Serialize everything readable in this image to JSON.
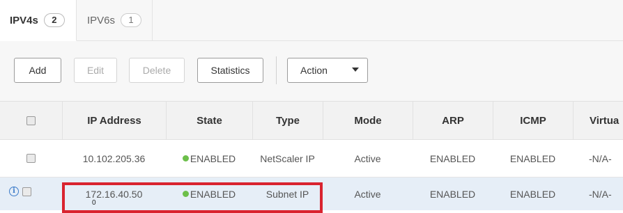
{
  "tabs": [
    {
      "label": "IPV4s",
      "count": "2",
      "active": true
    },
    {
      "label": "IPV6s",
      "count": "1",
      "active": false
    }
  ],
  "toolbar": {
    "add": "Add",
    "edit": "Edit",
    "delete": "Delete",
    "statistics": "Statistics",
    "action": "Action"
  },
  "table": {
    "columns": [
      "IP Address",
      "State",
      "Type",
      "Mode",
      "ARP",
      "ICMP",
      "Virtua"
    ],
    "rows": [
      {
        "ip": "10.102.205.36",
        "state": "ENABLED",
        "type": "NetScaler IP",
        "mode": "Active",
        "arp": "ENABLED",
        "icmp": "ENABLED",
        "virtual": "-N/A-"
      },
      {
        "ip": "172.16.40.50",
        "state": "ENABLED",
        "type": "Subnet IP",
        "mode": "Active",
        "arp": "ENABLED",
        "icmp": "ENABLED",
        "virtual": "-N/A-"
      }
    ],
    "row2_subtext": "0"
  },
  "colors": {
    "enabled_dot": "#6cbf4a",
    "selected_row": "#e6eef7",
    "highlight_border": "#d9232f",
    "info_icon": "#3d7cc9"
  },
  "icons": {
    "info": "info-circle-icon",
    "dropdown": "caret-down-icon"
  }
}
